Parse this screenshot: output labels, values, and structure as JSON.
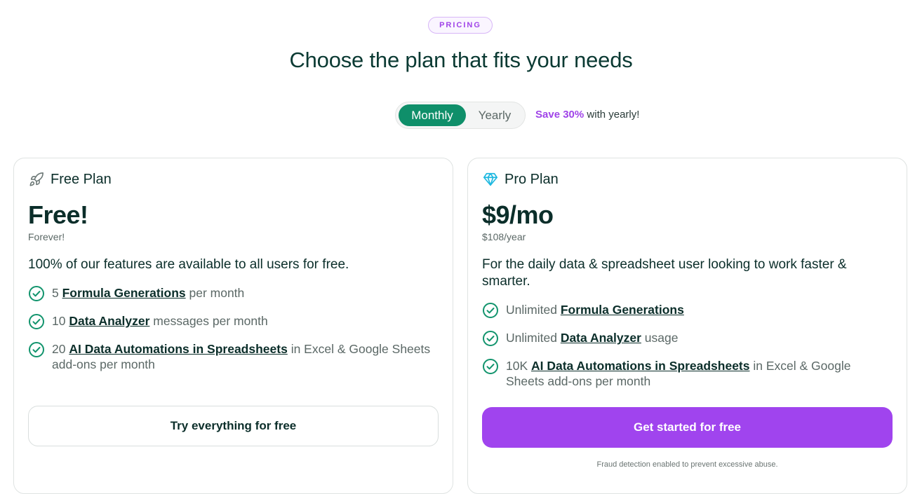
{
  "badge": "PRICING",
  "headline": "Choose the plan that fits your needs",
  "billing_toggle": {
    "monthly": "Monthly",
    "yearly": "Yearly",
    "selected": "Monthly",
    "save_highlight": "Save 30%",
    "save_rest": " with yearly!"
  },
  "plans": [
    {
      "name": "Free Plan",
      "icon": "rocket-icon",
      "price": "Free!",
      "price_sub": "Forever!",
      "description": "100% of our features are available to all users for free.",
      "features": [
        {
          "prefix": "5 ",
          "link": "Formula Generations",
          "suffix": " per month"
        },
        {
          "prefix": "10 ",
          "link": "Data Analyzer",
          "suffix": " messages per month"
        },
        {
          "prefix": "20 ",
          "link": "AI Data Automations in Spreadsheets",
          "suffix": " in Excel & Google Sheets add-ons per month"
        }
      ],
      "cta": "Try everything for free"
    },
    {
      "name": "Pro Plan",
      "icon": "diamond-icon",
      "price": "$9/mo",
      "price_sub": "$108/year",
      "description": "For the daily data & spreadsheet user looking to work faster & smarter.",
      "features": [
        {
          "prefix": "Unlimited ",
          "link": "Formula Generations",
          "suffix": ""
        },
        {
          "prefix": "Unlimited ",
          "link": "Data Analyzer",
          "suffix": " usage"
        },
        {
          "prefix": "10K ",
          "link": "AI Data Automations in Spreadsheets",
          "suffix": " in Excel & Google Sheets add-ons per month"
        }
      ],
      "cta": "Get started for free",
      "fineprint": "Fraud detection enabled to prevent excessive abuse."
    }
  ],
  "colors": {
    "primary_green": "#0f8f6a",
    "accent_purple": "#a044ee",
    "text_dark": "#0b2e2a",
    "text_muted": "#5b6866",
    "check_green": "#12946d",
    "diamond_cyan": "#1eb8e0"
  }
}
